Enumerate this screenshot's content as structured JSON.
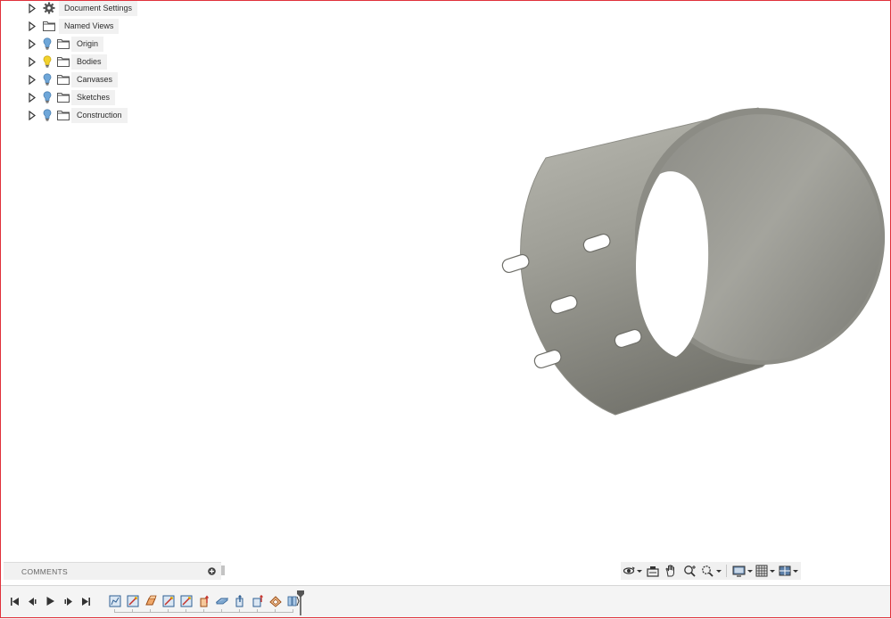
{
  "browser": {
    "items": [
      {
        "label": "Document Settings",
        "icon": "gear-icon",
        "visibility": "none"
      },
      {
        "label": "Named Views",
        "icon": "folder-icon",
        "visibility": "none"
      },
      {
        "label": "Origin",
        "icon": "folder-icon",
        "visibility": "off"
      },
      {
        "label": "Bodies",
        "icon": "folder-icon",
        "visibility": "on"
      },
      {
        "label": "Canvases",
        "icon": "folder-icon",
        "visibility": "off"
      },
      {
        "label": "Sketches",
        "icon": "folder-icon",
        "visibility": "off"
      },
      {
        "label": "Construction",
        "icon": "folder-icon",
        "visibility": "off"
      }
    ]
  },
  "comments": {
    "label": "COMMENTS"
  },
  "colors": {
    "frame": "#e0313b",
    "model_body": "#a8a8a0",
    "lightbulb_on": "#f2d22e",
    "lightbulb_off": "#6fa7d9",
    "panel_bg": "#f1f1f1"
  },
  "navbar": {
    "tools": [
      "orbit-icon",
      "look-at-icon",
      "pan-icon",
      "zoom-icon",
      "fit-icon",
      "display-settings-icon",
      "grid-settings-icon",
      "viewports-icon"
    ]
  },
  "timeline": {
    "playback": [
      "go-to-start-icon",
      "step-back-icon",
      "play-icon",
      "step-forward-icon",
      "go-to-end-icon"
    ],
    "features": [
      "sketch-icon",
      "sketch-icon",
      "extrude-icon",
      "sketch-icon",
      "sketch-icon",
      "extrude-icon",
      "plane-icon",
      "extrude-icon",
      "extrude-icon",
      "shell-icon",
      "pattern-icon"
    ]
  }
}
